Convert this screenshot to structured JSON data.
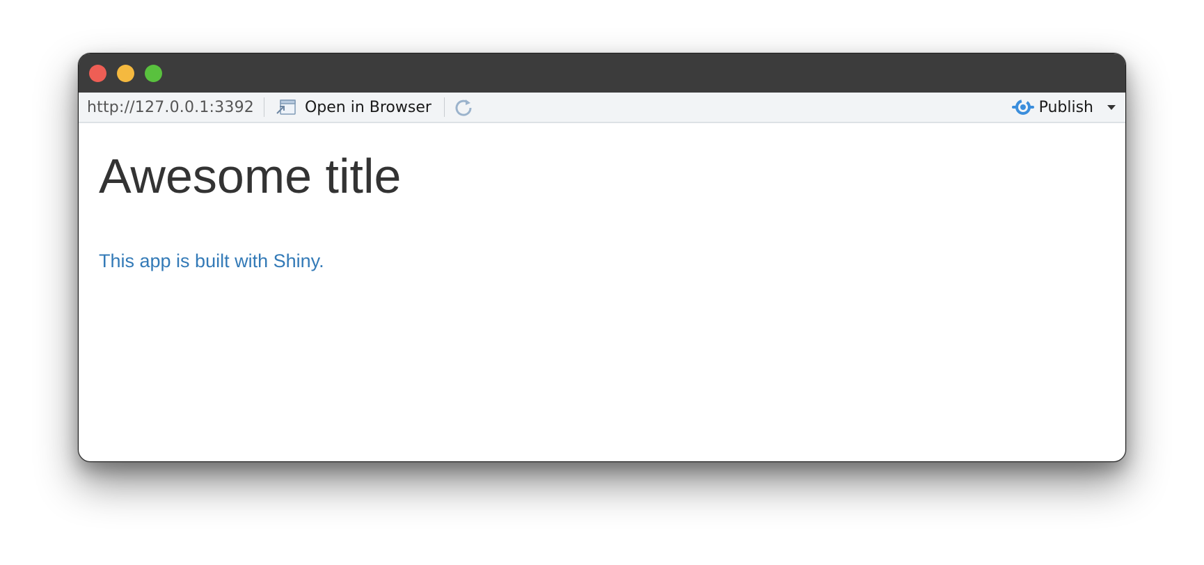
{
  "window": {
    "controls": {
      "close_color": "#ee5e55",
      "minimize_color": "#f5b93f",
      "zoom_color": "#59c13e"
    }
  },
  "toolbar": {
    "url": "http://127.0.0.1:3392",
    "open_in_browser_label": "Open in Browser",
    "open_in_browser_icon": "open-external-icon",
    "refresh_icon": "refresh-icon",
    "publish_label": "Publish",
    "publish_icon": "publish-icon",
    "publish_color": "#3b8edc"
  },
  "app": {
    "title": "Awesome title",
    "link_text": "This app is built with Shiny.",
    "link_color": "#337ab7"
  }
}
